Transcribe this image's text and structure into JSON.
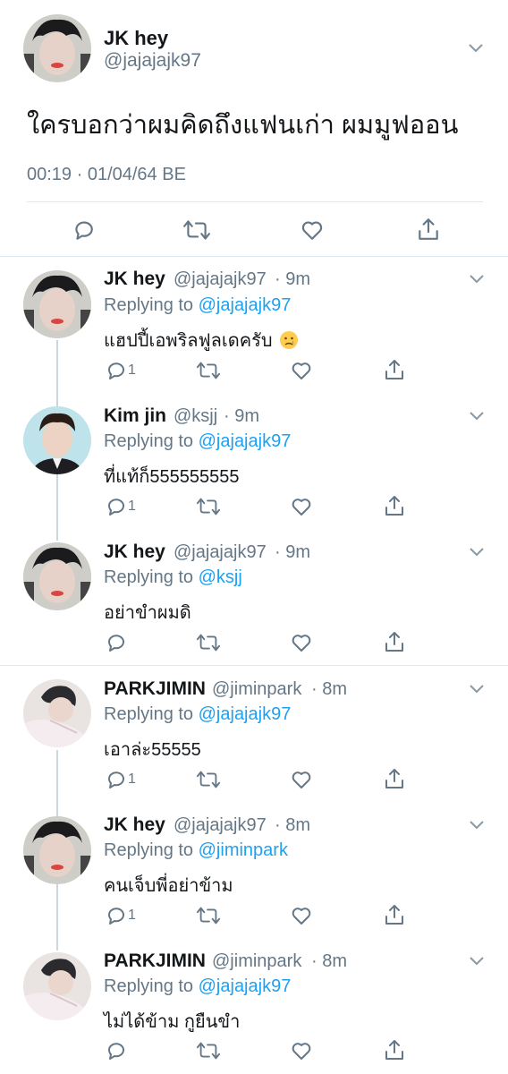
{
  "main_tweet": {
    "name": "JK hey",
    "handle": "@jajajajk97",
    "text": "ใครบอกว่าผมคิดถึงแฟนเก่า ผมมูฟออน",
    "timestamp": "00:19 · 01/04/64 BE",
    "actions": [
      "reply-icon",
      "retweet-icon",
      "like-icon",
      "share-icon"
    ]
  },
  "replies": [
    {
      "name": "JK hey",
      "handle": "@jajajajk97",
      "time": "· 9m",
      "replying_prefix": "Replying to ",
      "replying_to": "@jajajajk97",
      "text": "แฮปปี้เอพริลฟูลเดครับ",
      "emoji": "crying-face-emoji",
      "reply_count": "1"
    },
    {
      "name": "Kim jin",
      "handle": "@ksjj",
      "time": "· 9m",
      "replying_prefix": "Replying to ",
      "replying_to": "@jajajajk97",
      "text": "ที่แท้ก็555555555",
      "reply_count": "1"
    },
    {
      "name": "JK hey",
      "handle": "@jajajajk97",
      "time": "· 9m",
      "replying_prefix": "Replying to ",
      "replying_to": "@ksjj",
      "text": "อย่าขำผมดิ",
      "reply_count": ""
    },
    {
      "name": "PARKJIMIN",
      "handle": "@jiminpark",
      "time": "· 8m",
      "replying_prefix": "Replying to ",
      "replying_to": "@jajajajk97",
      "text": "เอาล่ะ55555",
      "reply_count": "1"
    },
    {
      "name": "JK hey",
      "handle": "@jajajajk97",
      "time": "· 8m",
      "replying_prefix": "Replying to ",
      "replying_to": "@jiminpark",
      "text": "คนเจ็บพี่อย่าข้าม",
      "reply_count": "1"
    },
    {
      "name": "PARKJIMIN",
      "handle": "@jiminpark",
      "time": "· 8m",
      "replying_prefix": "Replying to ",
      "replying_to": "@jajajajk97",
      "text": "ไม่ได้ข้าม กูยืนขำ",
      "reply_count": ""
    }
  ],
  "colors": {
    "accent": "#1da1f2",
    "muted": "#657786",
    "text": "#14171a",
    "divider": "#e1e8ed"
  }
}
